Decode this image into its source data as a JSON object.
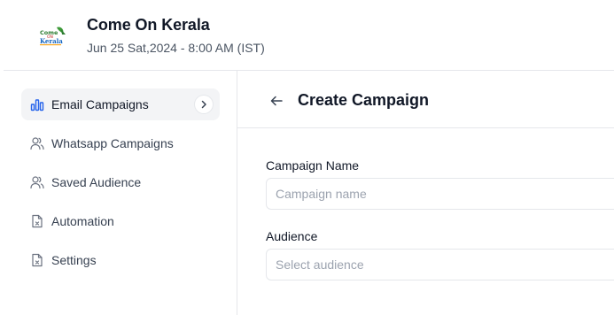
{
  "event": {
    "name": "Come On Kerala",
    "datetime": "Jun 25 Sat,2024 - 8:00 AM (IST)",
    "logo_text": "Come On Kerala"
  },
  "sidebar": {
    "items": [
      {
        "label": "Email Campaigns",
        "icon": "bar-chart-icon",
        "active": true
      },
      {
        "label": "Whatsapp Campaigns",
        "icon": "users-icon",
        "active": false
      },
      {
        "label": "Saved Audience",
        "icon": "users-icon",
        "active": false
      },
      {
        "label": "Automation",
        "icon": "file-x-icon",
        "active": false
      },
      {
        "label": "Settings",
        "icon": "file-x-icon",
        "active": false
      }
    ]
  },
  "main": {
    "title": "Create Campaign",
    "campaign_name": {
      "label": "Campaign Name",
      "placeholder": "Campaign name",
      "value": ""
    },
    "audience": {
      "label": "Audience",
      "placeholder": "Select audience"
    }
  },
  "colors": {
    "accent": "#2563eb",
    "active_bg": "#f3f4f6",
    "border": "#e5e7eb",
    "muted_text": "#9ca3af"
  }
}
